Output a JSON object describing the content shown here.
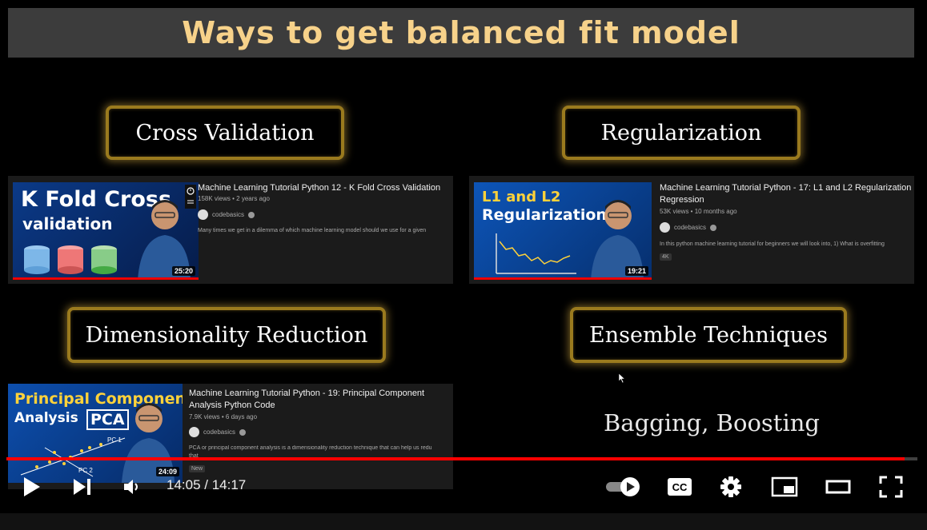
{
  "slide": {
    "title": "Ways to get balanced fit model",
    "labels": {
      "cross_validation": "Cross Validation",
      "regularization": "Regularization",
      "dimensionality_reduction": "Dimensionality Reduction",
      "ensemble_techniques": "Ensemble Techniques"
    },
    "ensemble_text": "Bagging, Boosting"
  },
  "videos": [
    {
      "thumb_line1": "K Fold Cross",
      "thumb_line2": "validation",
      "duration": "25:20",
      "title": "Machine Learning Tutorial Python 12 - K Fold Cross Validation",
      "meta": "158K views • 2 years ago",
      "channel": "codebasics",
      "description": "Many times we get in a dilemma of which machine learning model should we use for a given"
    },
    {
      "thumb_line1": "L1 and L2",
      "thumb_line2": "Regularization",
      "duration": "19:21",
      "title": "Machine Learning Tutorial Python - 17: L1 and L2 Regularization Regression",
      "meta": "53K views • 10 months ago",
      "channel": "codebasics",
      "description": "In this python machine learning tutorial for beginners we will look into, 1) What is overfitting",
      "tag": "4K"
    },
    {
      "thumb_line1": "Principal Component",
      "thumb_line2": "Analysis",
      "thumb_badge": "PCA",
      "pc1": "PC 1",
      "pc2": "PC 2",
      "duration": "24:09",
      "title": "Machine Learning Tutorial Python - 19: Principal Component Analysis Python Code",
      "meta": "7.9K views • 6 days ago",
      "channel": "codebasics",
      "description": "PCA or principal component analysis is a dimensionality reduction technique that can help us redu",
      "description2": "that",
      "tag": "New"
    }
  ],
  "player": {
    "time": "14:05 / 14:17",
    "progress": 0.986,
    "icons": [
      "play-icon",
      "next-icon",
      "volume-icon",
      "autoplay-toggle-icon",
      "captions-icon",
      "settings-icon",
      "miniplayer-icon",
      "theater-icon",
      "fullscreen-icon"
    ],
    "captions_label": "CC",
    "accent": "#ff0000"
  }
}
